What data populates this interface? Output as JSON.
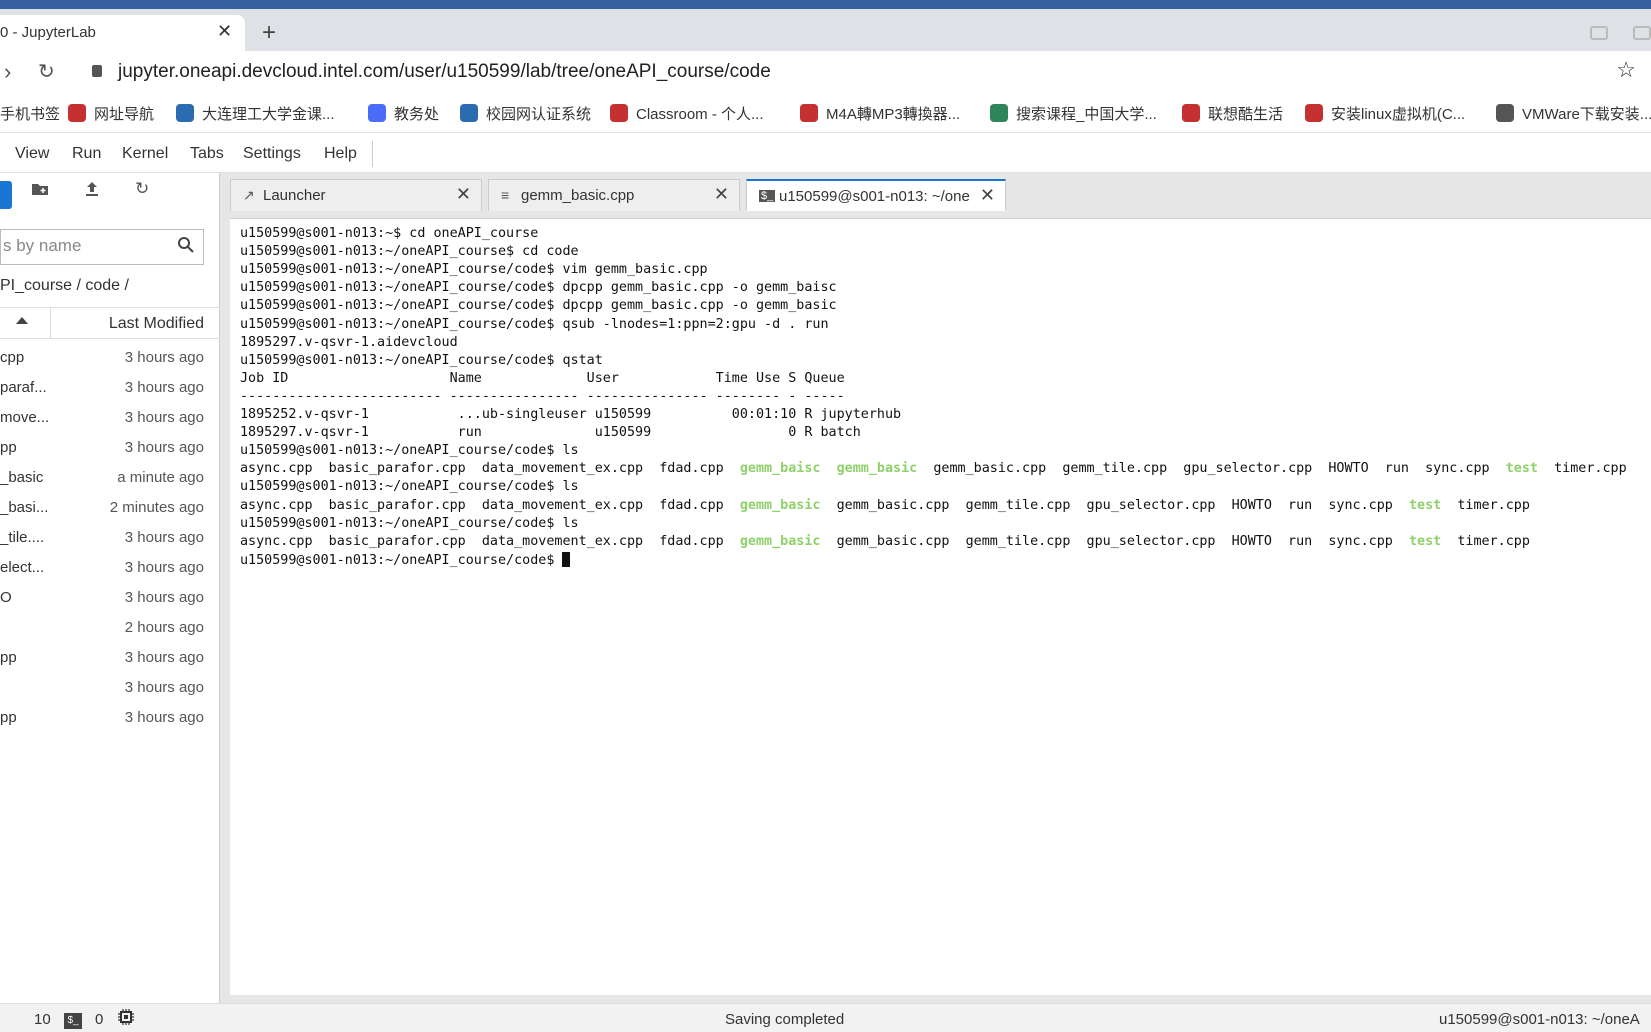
{
  "browser": {
    "tab_title": "0 - JupyterLab",
    "tab_close": "✕",
    "new_tab": "+",
    "url": "jupyter.oneapi.devcloud.intel.com/user/u150599/lab/tree/oneAPI_course/code",
    "bookmarks": [
      {
        "label": "手机书签",
        "color": "#2b6cb0"
      },
      {
        "label": "网址导航",
        "color": "#c53030"
      },
      {
        "label": "大连理工大学金课...",
        "color": "#2b6cb0"
      },
      {
        "label": "教务处",
        "color": "#4a6cf7"
      },
      {
        "label": "校园网认证系统",
        "color": "#2b6cb0"
      },
      {
        "label": "Classroom - 个人...",
        "color": "#c53030"
      },
      {
        "label": "M4A轉MP3轉換器...",
        "color": "#c53030"
      },
      {
        "label": "搜索课程_中国大学...",
        "color": "#2f855a"
      },
      {
        "label": "联想酷生活",
        "color": "#c53030"
      },
      {
        "label": "安装linux虚拟机(C...",
        "color": "#c53030"
      },
      {
        "label": "VMWare下载安装...",
        "color": "#555555"
      }
    ]
  },
  "menu": {
    "items": [
      "View",
      "Run",
      "Kernel",
      "Tabs",
      "Settings",
      "Help"
    ]
  },
  "sidebar": {
    "filter_placeholder": "s by name",
    "breadcrumb": "PI_course / code /",
    "col_modified": "Last Modified",
    "files": [
      {
        "name": "cpp",
        "modified": "3 hours ago"
      },
      {
        "name": "paraf...",
        "modified": "3 hours ago"
      },
      {
        "name": "move...",
        "modified": "3 hours ago"
      },
      {
        "name": "pp",
        "modified": "3 hours ago"
      },
      {
        "name": "_basic",
        "modified": "a minute ago"
      },
      {
        "name": "_basi...",
        "modified": "2 minutes ago"
      },
      {
        "name": "_tile....",
        "modified": "3 hours ago"
      },
      {
        "name": "elect...",
        "modified": "3 hours ago"
      },
      {
        "name": "O",
        "modified": "3 hours ago"
      },
      {
        "name": "",
        "modified": "2 hours ago"
      },
      {
        "name": "pp",
        "modified": "3 hours ago"
      },
      {
        "name": "",
        "modified": "3 hours ago"
      },
      {
        "name": "pp",
        "modified": "3 hours ago"
      }
    ]
  },
  "tabs": [
    {
      "label": "Launcher",
      "icon": "↗",
      "close": "✕"
    },
    {
      "label": "gemm_basic.cpp",
      "icon": "≡",
      "close": "✕"
    },
    {
      "label": "u150599@s001-n013: ~/one",
      "icon": "$_",
      "close": "✕"
    }
  ],
  "terminal": {
    "lines": [
      "u150599@s001-n013:~$ cd oneAPI_course",
      "u150599@s001-n013:~/oneAPI_course$ cd code",
      "u150599@s001-n013:~/oneAPI_course/code$ vim gemm_basic.cpp",
      "u150599@s001-n013:~/oneAPI_course/code$ dpcpp gemm_basic.cpp -o gemm_baisc",
      "u150599@s001-n013:~/oneAPI_course/code$ dpcpp gemm_basic.cpp -o gemm_basic",
      "u150599@s001-n013:~/oneAPI_course/code$ qsub -lnodes=1:ppn=2:gpu -d . run",
      "1895297.v-qsvr-1.aidevcloud",
      "u150599@s001-n013:~/oneAPI_course/code$ qstat",
      "Job ID                    Name             User            Time Use S Queue",
      "------------------------- ---------------- --------------- -------- - -----",
      "1895252.v-qsvr-1           ...ub-singleuser u150599          00:01:10 R jupyterhub",
      "1895297.v-qsvr-1           run              u150599                 0 R batch",
      "u150599@s001-n013:~/oneAPI_course/code$ ls"
    ],
    "ls_output_1": [
      {
        "t": "async.cpp  basic_parafor.cpp  data_movement_ex.cpp  fdad.cpp  ",
        "g": false
      },
      {
        "t": "gemm_baisc",
        "g": true
      },
      {
        "t": "  ",
        "g": false
      },
      {
        "t": "gemm_basic",
        "g": true
      },
      {
        "t": "  gemm_basic.cpp  gemm_tile.cpp  gpu_selector.cpp  HOWTO  run  sync.cpp  ",
        "g": false
      },
      {
        "t": "test",
        "g": true
      },
      {
        "t": "  timer.cpp",
        "g": false
      }
    ],
    "prompt_ls_2": "u150599@s001-n013:~/oneAPI_course/code$ ls",
    "ls_output_2": [
      {
        "t": "async.cpp  basic_parafor.cpp  data_movement_ex.cpp  fdad.cpp  ",
        "g": false
      },
      {
        "t": "gemm_basic",
        "g": true
      },
      {
        "t": "  gemm_basic.cpp  gemm_tile.cpp  gpu_selector.cpp  HOWTO  run  sync.cpp  ",
        "g": false
      },
      {
        "t": "test",
        "g": true
      },
      {
        "t": "  timer.cpp",
        "g": false
      }
    ],
    "prompt_ls_3": "u150599@s001-n013:~/oneAPI_course/code$ ls",
    "ls_output_3": [
      {
        "t": "async.cpp  basic_parafor.cpp  data_movement_ex.cpp  fdad.cpp  ",
        "g": false
      },
      {
        "t": "gemm_basic",
        "g": true
      },
      {
        "t": "  gemm_basic.cpp  gemm_tile.cpp  gpu_selector.cpp  HOWTO  run  sync.cpp  ",
        "g": false
      },
      {
        "t": "test",
        "g": true
      },
      {
        "t": "  timer.cpp",
        "g": false
      }
    ],
    "final_prompt": "u150599@s001-n013:~/oneAPI_course/code$ "
  },
  "status": {
    "count_a": "10",
    "count_b": "0",
    "message": "Saving completed",
    "right": "u150599@s001-n013: ~/oneA"
  }
}
